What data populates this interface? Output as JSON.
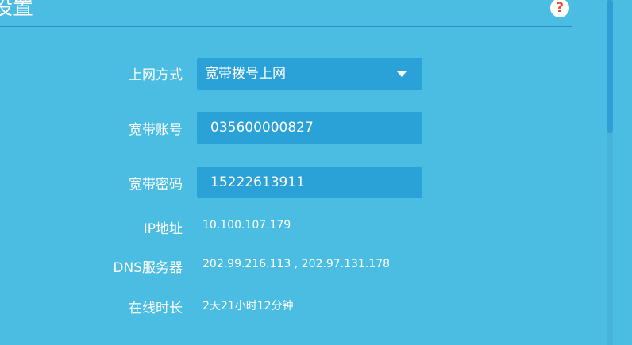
{
  "header": {
    "title": "设置",
    "help_icon": "?"
  },
  "form": {
    "connection_type": {
      "label": "上网方式",
      "value": "宽带拨号上网"
    },
    "account": {
      "label": "宽带账号",
      "value": "035600000827"
    },
    "password": {
      "label": "宽带密码",
      "value": "15222613911"
    },
    "ip": {
      "label": "IP地址",
      "value": "10.100.107.179"
    },
    "dns": {
      "label": "DNS服务器",
      "value": "202.99.216.113 , 202.97.131.178"
    },
    "uptime": {
      "label": "在线时长",
      "value": "2天21小时12分钟"
    }
  },
  "colors": {
    "background": "#4bbde2",
    "field": "#2aa2d8",
    "divider": "#2e8fc4",
    "help_icon": "#e84a2c"
  }
}
